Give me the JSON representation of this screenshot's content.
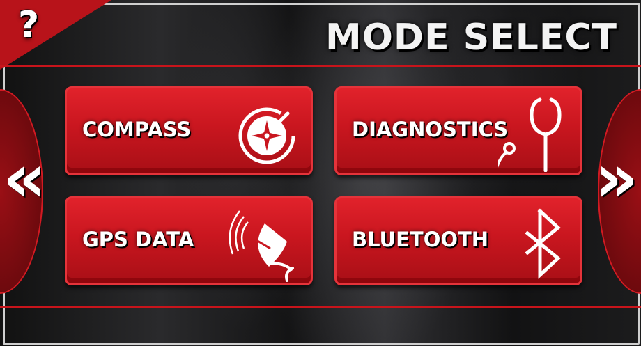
{
  "header": {
    "title": "MODE SELECT",
    "help_label": "?"
  },
  "navigation": {
    "prev_label": "«",
    "next_label": "»"
  },
  "modes": [
    {
      "label": "COMPASS",
      "icon": "compass-icon"
    },
    {
      "label": "DIAGNOSTICS",
      "icon": "stethoscope-icon"
    },
    {
      "label": "GPS DATA",
      "icon": "satellite-dish-icon"
    },
    {
      "label": "BLUETOOTH",
      "icon": "bluetooth-icon"
    }
  ],
  "colors": {
    "accent": "#c8141b",
    "button_fill": "#d01b23",
    "text": "#ffffff",
    "background": "#141415"
  }
}
